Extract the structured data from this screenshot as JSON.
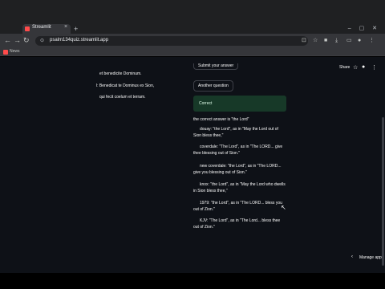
{
  "browser": {
    "tab_title": "Streamlit",
    "tab_close": "×",
    "new_tab": "+",
    "window_controls": "–  ▢  ✕",
    "url": "psalm134quiz.streamlit.app",
    "back": "←",
    "forward": "→",
    "reload": "↻",
    "bookmark_label": "News"
  },
  "header": {
    "share_label": "Share",
    "star_icon": "☆",
    "github_icon": "●",
    "menu_icon": "⋮"
  },
  "left_column": {
    "lines": [
      "et benedicite Dominum.",
      "l: Benedicat te Dominus ex Sion,",
      "qui fecit coelum et terram."
    ]
  },
  "main": {
    "partial_button": "Submit your answer",
    "another_question": "Another question",
    "success_text": "Correct",
    "answer_line": "the correct answer is \"the Lord\"",
    "translations": [
      "douay: \"the Lord\", as in \"May the Lord out of Sion bless thee,\"",
      "coverdale: \"The Lord\", as in \"The LORD... give thee blessing out of Sion.\"",
      "new coverdale: \"the Lord\", as in \"The LORD... give you blessing out of Sion.\"",
      "knox: \"the Lord\", as in \"May the Lord who dwells in Sion bless thee,\"",
      "1979: \"the Lord\", as in \"The LORD... bless you out of Zion.\"",
      "KJV: \"The Lord\", as in \"The Lord... bless thee out of Zion.\""
    ]
  },
  "footer": {
    "manage_app": "Manage app",
    "chevron": "‹"
  },
  "colors": {
    "app_bg": "#0e1117",
    "success_bg": "#173928",
    "brand": "#ff4b4b"
  }
}
